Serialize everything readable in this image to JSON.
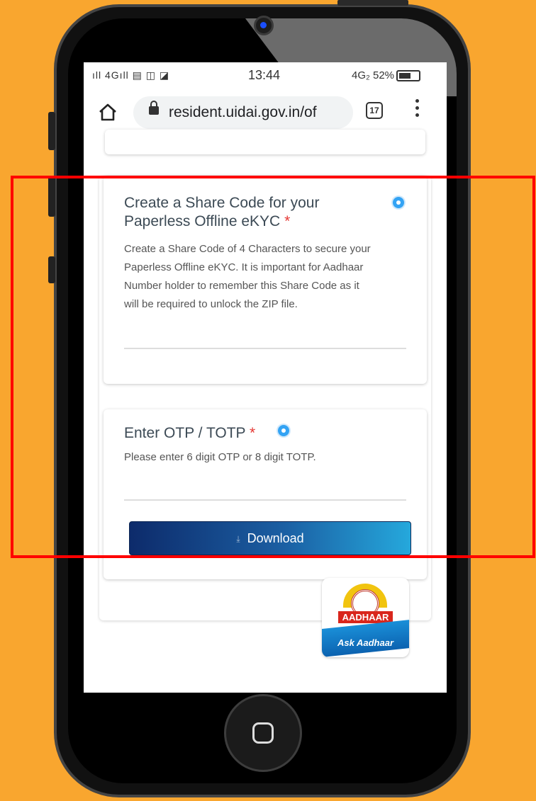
{
  "status_bar": {
    "left_icons": "ıll 4Gıll ▤ ◫ ◪",
    "time": "13:44",
    "right_text": "4G₂ 52%"
  },
  "browser": {
    "url": "resident.uidai.gov.in/of",
    "tab_count": "17"
  },
  "share_code_section": {
    "title_line1": "Create a Share Code for your",
    "title_line2": "Paperless Offline eKYC",
    "required_mark": "*",
    "description_lines": [
      "Create a Share Code of 4 Characters to secure your",
      "Paperless Offline eKYC. It is important for Aadhaar",
      "Number holder to remember this Share Code as it",
      "will be required to unlock the ZIP file."
    ]
  },
  "otp_section": {
    "title": "Enter OTP / TOTP",
    "required_mark": "*",
    "description": "Please enter 6 digit OTP or 8 digit TOTP."
  },
  "download_button": {
    "label": "Download"
  },
  "ask_aadhaar_widget": {
    "brand": "AADHAAR",
    "label": "Ask Aadhaar"
  },
  "colors": {
    "background": "#F9A62F",
    "highlight_border": "#FF0000",
    "required_mark": "#E53935",
    "button_start": "#0D2B6B",
    "button_end": "#25A8DC"
  },
  "icons": [
    "home-icon",
    "lock-icon",
    "tab-switcher-icon",
    "more-options-icon",
    "info-icon",
    "download-icon"
  ]
}
